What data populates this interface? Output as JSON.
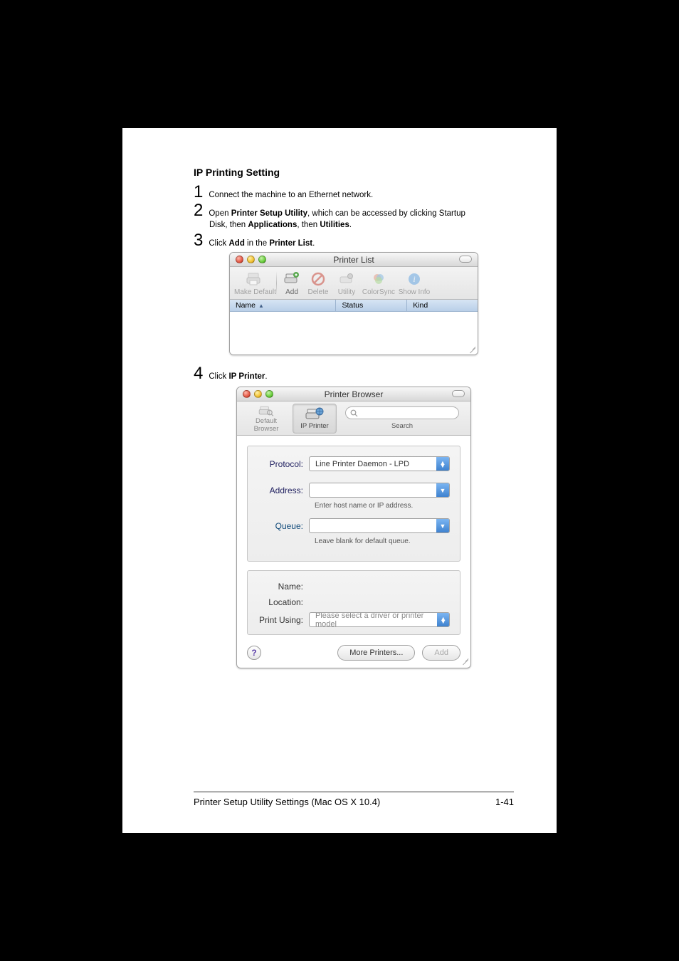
{
  "heading": "IP Printing Setting",
  "steps": {
    "s1": {
      "num": "1",
      "text": "Connect the machine to an Ethernet network."
    },
    "s2": {
      "num": "2",
      "line1_a": "Open ",
      "line1_b": "Printer Setup Utility",
      "line1_c": ", which can be accessed by clicking Startup",
      "line2_a": "Disk, then ",
      "line2_b": "Applications",
      "line2_c": ", then ",
      "line2_d": "Utilities",
      "line2_e": "."
    },
    "s3": {
      "num": "3",
      "a": "Click ",
      "b": "Add",
      "c": " in the ",
      "d": "Printer List",
      "e": "."
    },
    "s4": {
      "num": "4",
      "a": "Click ",
      "b": "IP Printer",
      "c": "."
    }
  },
  "printerList": {
    "title": "Printer List",
    "toolbar": {
      "makeDefault": "Make Default",
      "add": "Add",
      "delete": "Delete",
      "utility": "Utility",
      "colorSync": "ColorSync",
      "showInfo": "Show Info"
    },
    "columns": {
      "name": "Name",
      "status": "Status",
      "kind": "Kind"
    }
  },
  "browser": {
    "title": "Printer Browser",
    "tabs": {
      "default": "Default Browser",
      "ip": "IP Printer",
      "search": "Search"
    },
    "fields": {
      "protocolLabel": "Protocol:",
      "protocolValue": "Line Printer Daemon - LPD",
      "addressLabel": "Address:",
      "addressHint": "Enter host name or IP address.",
      "queueLabel": "Queue:",
      "queueHint": "Leave blank for default queue.",
      "nameLabel": "Name:",
      "locationLabel": "Location:",
      "printUsingLabel": "Print Using:",
      "printUsingValue": "Please select a driver or printer model"
    },
    "buttons": {
      "more": "More Printers...",
      "add": "Add"
    }
  },
  "footer": {
    "left": "Printer Setup Utility Settings (Mac OS X 10.4)",
    "right": "1-41"
  }
}
